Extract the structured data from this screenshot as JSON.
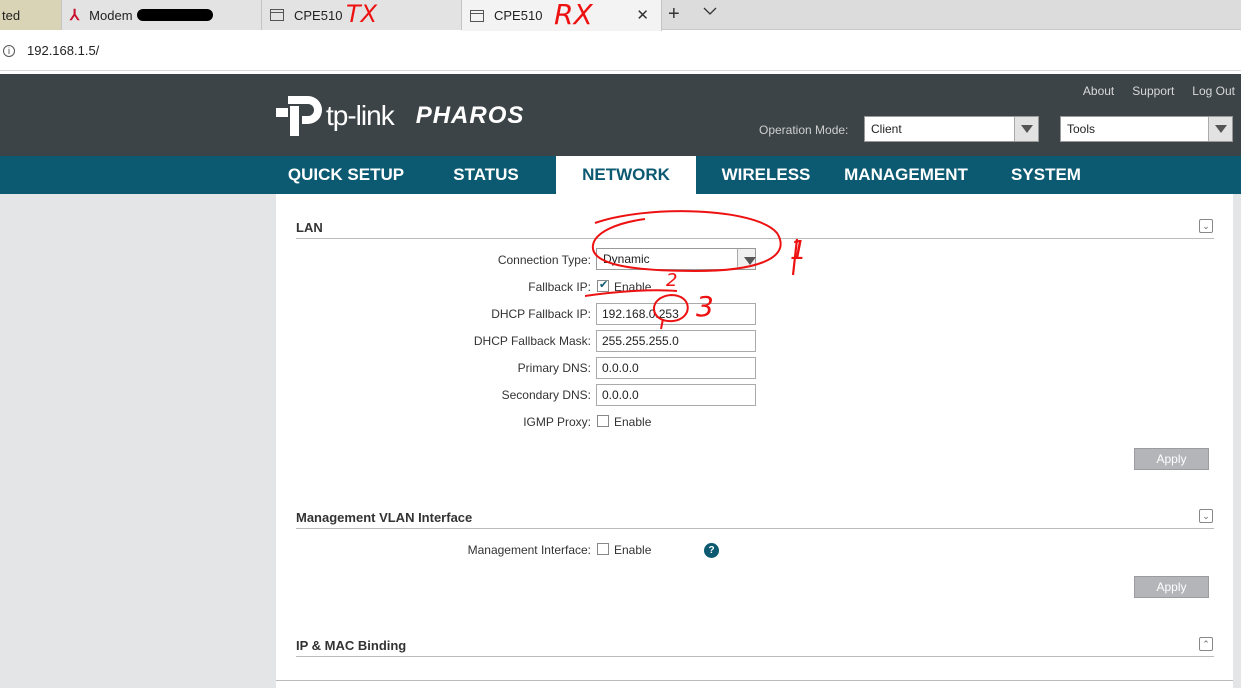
{
  "browser": {
    "tabs": [
      {
        "label": "ted"
      },
      {
        "label": "Modem"
      },
      {
        "label": "CPE510"
      },
      {
        "label": "CPE510"
      }
    ],
    "new_tab": "+",
    "tab_list": "⌄",
    "close": "✕",
    "url": "192.168.1.5/",
    "annotations": {
      "tx": "TX",
      "rx": "RX",
      "n1": "1",
      "n2": "2",
      "n3": "3"
    }
  },
  "header": {
    "logo_text": "tp-link",
    "logo_product": "PHAROS",
    "links": [
      "About",
      "Support",
      "Log Out"
    ],
    "operation_mode_label": "Operation Mode:",
    "operation_mode_value": "Client",
    "tools_value": "Tools"
  },
  "nav": {
    "items": [
      "QUICK SETUP",
      "STATUS",
      "NETWORK",
      "WIRELESS",
      "MANAGEMENT",
      "SYSTEM"
    ],
    "active": "NETWORK"
  },
  "lan": {
    "title": "LAN",
    "connection_type_label": "Connection Type:",
    "connection_type_value": "Dynamic",
    "fallback_ip_label": "Fallback IP:",
    "fallback_ip_enable": "Enable",
    "dhcp_fallback_ip_label": "DHCP Fallback IP:",
    "dhcp_fallback_ip_value": "192.168.0.253",
    "dhcp_fallback_mask_label": "DHCP Fallback Mask:",
    "dhcp_fallback_mask_value": "255.255.255.0",
    "primary_dns_label": "Primary DNS:",
    "primary_dns_value": "0.0.0.0",
    "secondary_dns_label": "Secondary DNS:",
    "secondary_dns_value": "0.0.0.0",
    "igmp_proxy_label": "IGMP Proxy:",
    "igmp_proxy_enable": "Enable",
    "apply": "Apply"
  },
  "mgmt_vlan": {
    "title": "Management VLAN Interface",
    "interface_label": "Management Interface:",
    "interface_enable": "Enable",
    "help": "?",
    "apply": "Apply"
  },
  "ip_mac": {
    "title": "IP & MAC Binding"
  },
  "icons": {
    "collapse_down": "⌄",
    "collapse_up": "⌃",
    "info": "i"
  }
}
